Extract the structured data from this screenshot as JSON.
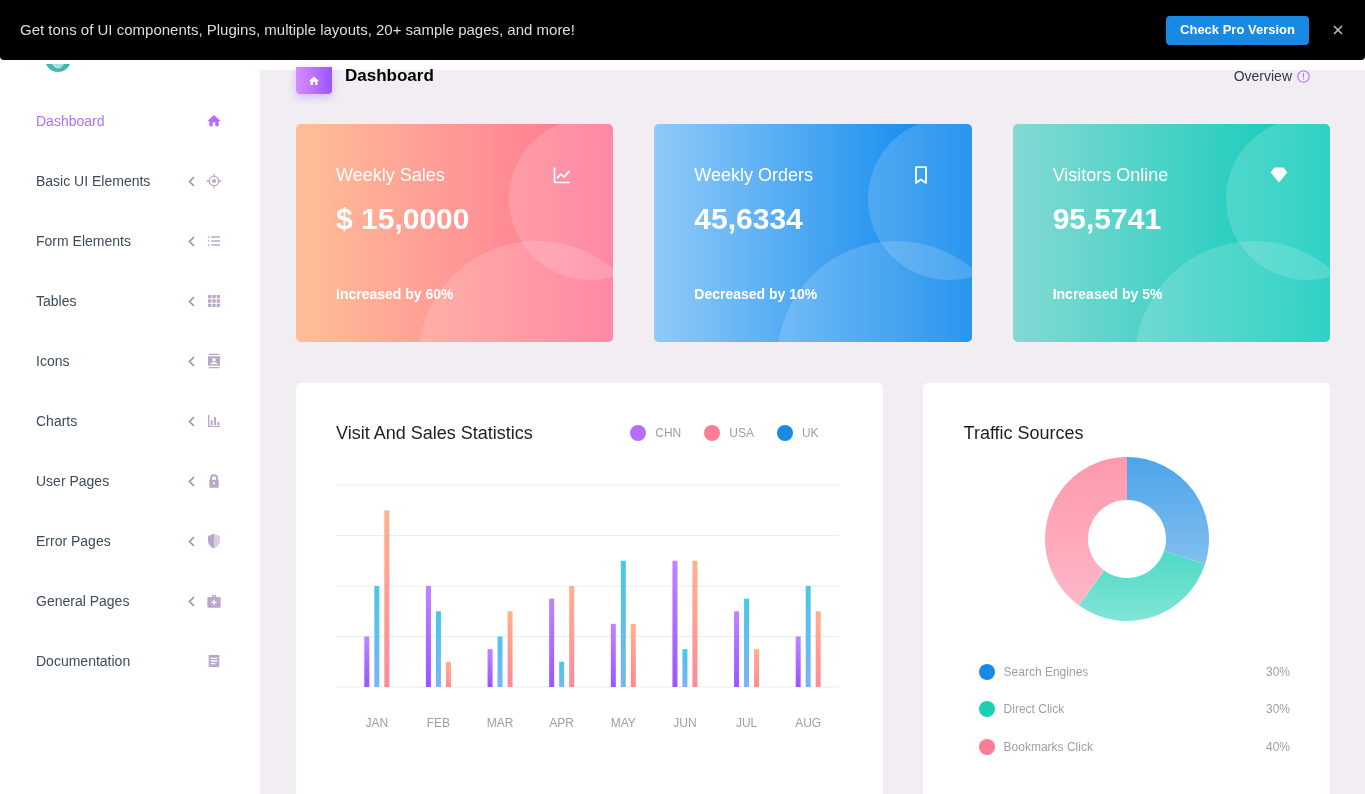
{
  "banner": {
    "text": "Get tons of UI components, Plugins, multiple layouts, 20+ sample pages, and more!",
    "button": "Check Pro Version"
  },
  "sidebar": {
    "items": [
      {
        "label": "Dashboard",
        "selected": true,
        "has_submenu": false
      },
      {
        "label": "Basic UI Elements",
        "selected": false,
        "has_submenu": true
      },
      {
        "label": "Form Elements",
        "selected": false,
        "has_submenu": true
      },
      {
        "label": "Tables",
        "selected": false,
        "has_submenu": true
      },
      {
        "label": "Icons",
        "selected": false,
        "has_submenu": true
      },
      {
        "label": "Charts",
        "selected": false,
        "has_submenu": true
      },
      {
        "label": "User Pages",
        "selected": false,
        "has_submenu": true
      },
      {
        "label": "Error Pages",
        "selected": false,
        "has_submenu": true
      },
      {
        "label": "General Pages",
        "selected": false,
        "has_submenu": true
      },
      {
        "label": "Documentation",
        "selected": false,
        "has_submenu": false
      }
    ]
  },
  "page_header": {
    "title": "Dashboard",
    "breadcrumb": "Overview"
  },
  "stat_cards": [
    {
      "title": "Weekly Sales",
      "value": "$ 15,0000",
      "note": "Increased by 60%",
      "color": "#ffbf96"
    },
    {
      "title": "Weekly Orders",
      "value": "45,6334",
      "note": "Decreased by 10%",
      "color": "#90caf9"
    },
    {
      "title": "Visitors Online",
      "value": "95,5741",
      "note": "Increased by 5%",
      "color": "#84d9d2"
    }
  ],
  "sales_chart": {
    "title": "Visit And Sales Statistics",
    "legend": [
      {
        "label": "CHN",
        "color": "#b66dff"
      },
      {
        "label": "USA",
        "color": "#fe7c96"
      },
      {
        "label": "UK",
        "color": "#198ae3"
      }
    ],
    "month_labels": [
      "JAN",
      "FEB",
      "MAR",
      "APR",
      "MAY",
      "JUN",
      "JUL",
      "AUG"
    ]
  },
  "traffic_sources": {
    "title": "Traffic Sources",
    "chart_data": {
      "type": "donut",
      "categories": [
        "Search Engines",
        "Direct Click",
        "Bookmarks Click"
      ],
      "values": [
        30,
        30,
        40
      ]
    },
    "legend": [
      {
        "value": "30%",
        "color": "#198ae3"
      },
      {
        "value": "30%",
        "color": "#1bcfb4"
      },
      {
        "value": "40%",
        "color": "#fe7c96"
      }
    ]
  }
}
